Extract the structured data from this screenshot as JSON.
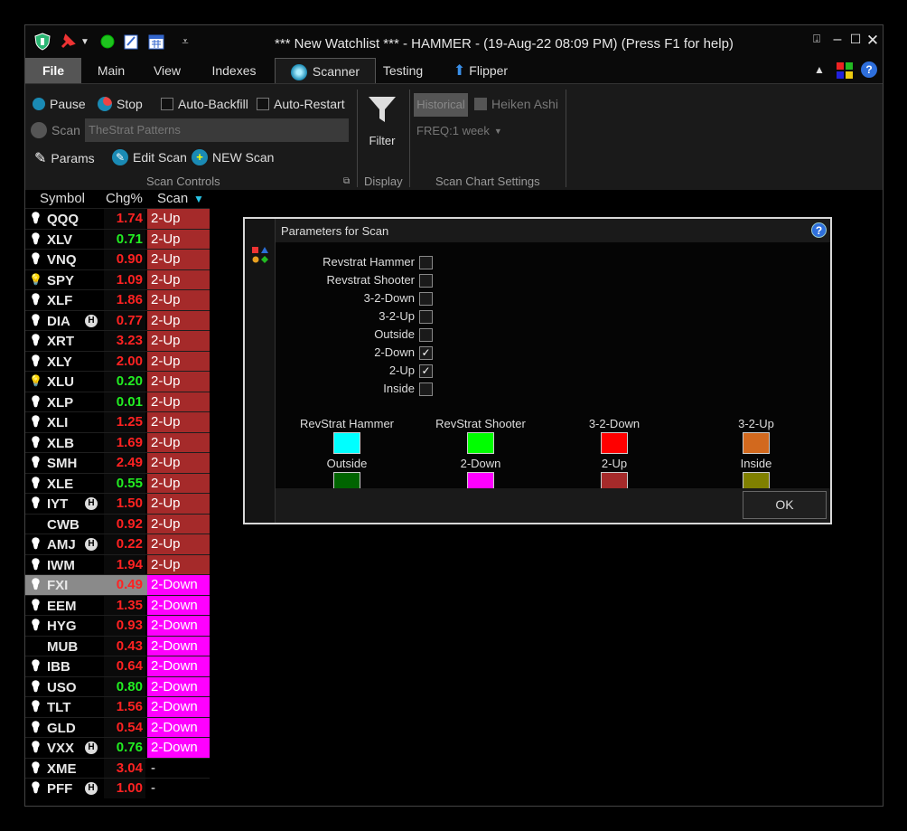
{
  "titlebar": {
    "title": "*** New Watchlist *** - HAMMER - (19-Aug-22 08:09 PM) (Press F1 for help)",
    "icons": [
      "shield-icon",
      "pin-icon",
      "dropdown-arrow-icon",
      "green-dot-icon",
      "notepad-icon",
      "calendar-icon",
      "dropdown-menu-icon"
    ],
    "controls": [
      "pin-window-icon",
      "minimize-icon",
      "maximize-icon",
      "close-icon"
    ]
  },
  "menu": {
    "tabs": [
      {
        "label": "File"
      },
      {
        "label": "Main"
      },
      {
        "label": "View"
      },
      {
        "label": "Indexes"
      },
      {
        "label": "Scanner"
      },
      {
        "label": "Testing"
      },
      {
        "label": "Flipper"
      }
    ]
  },
  "ribbon": {
    "pause_label": "Pause",
    "stop_label": "Stop",
    "auto_backfill_label": "Auto-Backfill",
    "auto_restart_label": "Auto-Restart",
    "scan_label": "Scan",
    "scan_name": "TheStrat Patterns",
    "params_label": "Params",
    "edit_scan_label": "Edit Scan",
    "new_scan_label": "NEW Scan",
    "filter_label": "Filter",
    "historical_label": "Historical",
    "heiken_ashi_label": "Heiken Ashi",
    "freq_label": "FREQ:1 week",
    "groups": {
      "scan_controls": "Scan Controls",
      "display": "Display",
      "scan_chart_settings": "Scan Chart Settings"
    }
  },
  "watchlist": {
    "headers": {
      "symbol": "Symbol",
      "chg": "Chg%",
      "scan": "Scan"
    },
    "rows": [
      {
        "symbol": "QQQ",
        "chg": "1.74",
        "scan": "2-Up",
        "up": false,
        "h": false,
        "bulb": "white"
      },
      {
        "symbol": "XLV",
        "chg": "0.71",
        "scan": "2-Up",
        "up": true,
        "h": false,
        "bulb": "white"
      },
      {
        "symbol": "VNQ",
        "chg": "0.90",
        "scan": "2-Up",
        "up": false,
        "h": false,
        "bulb": "white"
      },
      {
        "symbol": "SPY",
        "chg": "1.09",
        "scan": "2-Up",
        "up": false,
        "h": false,
        "bulb": "yellow"
      },
      {
        "symbol": "XLF",
        "chg": "1.86",
        "scan": "2-Up",
        "up": false,
        "h": false,
        "bulb": "white"
      },
      {
        "symbol": "DIA",
        "chg": "0.77",
        "scan": "2-Up",
        "up": false,
        "h": true,
        "bulb": "white"
      },
      {
        "symbol": "XRT",
        "chg": "3.23",
        "scan": "2-Up",
        "up": false,
        "h": false,
        "bulb": "white"
      },
      {
        "symbol": "XLY",
        "chg": "2.00",
        "scan": "2-Up",
        "up": false,
        "h": false,
        "bulb": "white"
      },
      {
        "symbol": "XLU",
        "chg": "0.20",
        "scan": "2-Up",
        "up": true,
        "h": false,
        "bulb": "yellow"
      },
      {
        "symbol": "XLP",
        "chg": "0.01",
        "scan": "2-Up",
        "up": true,
        "h": false,
        "bulb": "white"
      },
      {
        "symbol": "XLI",
        "chg": "1.25",
        "scan": "2-Up",
        "up": false,
        "h": false,
        "bulb": "white"
      },
      {
        "symbol": "XLB",
        "chg": "1.69",
        "scan": "2-Up",
        "up": false,
        "h": false,
        "bulb": "white"
      },
      {
        "symbol": "SMH",
        "chg": "2.49",
        "scan": "2-Up",
        "up": false,
        "h": false,
        "bulb": "white"
      },
      {
        "symbol": "XLE",
        "chg": "0.55",
        "scan": "2-Up",
        "up": true,
        "h": false,
        "bulb": "white"
      },
      {
        "symbol": "IYT",
        "chg": "1.50",
        "scan": "2-Up",
        "up": false,
        "h": true,
        "bulb": "white"
      },
      {
        "symbol": "CWB",
        "chg": "0.92",
        "scan": "2-Up",
        "up": false,
        "h": false,
        "bulb": "none"
      },
      {
        "symbol": "AMJ",
        "chg": "0.22",
        "scan": "2-Up",
        "up": false,
        "h": true,
        "bulb": "white"
      },
      {
        "symbol": "IWM",
        "chg": "1.94",
        "scan": "2-Up",
        "up": false,
        "h": false,
        "bulb": "white"
      },
      {
        "symbol": "FXI",
        "chg": "0.49",
        "scan": "2-Down",
        "up": false,
        "h": false,
        "bulb": "white",
        "selected": true
      },
      {
        "symbol": "EEM",
        "chg": "1.35",
        "scan": "2-Down",
        "up": false,
        "h": false,
        "bulb": "white"
      },
      {
        "symbol": "HYG",
        "chg": "0.93",
        "scan": "2-Down",
        "up": false,
        "h": false,
        "bulb": "white"
      },
      {
        "symbol": "MUB",
        "chg": "0.43",
        "scan": "2-Down",
        "up": false,
        "h": false,
        "bulb": "none"
      },
      {
        "symbol": "IBB",
        "chg": "0.64",
        "scan": "2-Down",
        "up": false,
        "h": false,
        "bulb": "white"
      },
      {
        "symbol": "USO",
        "chg": "0.80",
        "scan": "2-Down",
        "up": true,
        "h": false,
        "bulb": "white"
      },
      {
        "symbol": "TLT",
        "chg": "1.56",
        "scan": "2-Down",
        "up": false,
        "h": false,
        "bulb": "white"
      },
      {
        "symbol": "GLD",
        "chg": "0.54",
        "scan": "2-Down",
        "up": false,
        "h": false,
        "bulb": "white"
      },
      {
        "symbol": "VXX",
        "chg": "0.76",
        "scan": "2-Down",
        "up": true,
        "h": true,
        "bulb": "white"
      },
      {
        "symbol": "XME",
        "chg": "3.04",
        "scan": "-",
        "up": false,
        "h": false,
        "bulb": "white"
      },
      {
        "symbol": "PFF",
        "chg": "1.00",
        "scan": "-",
        "up": false,
        "h": true,
        "bulb": "white"
      }
    ]
  },
  "dialog": {
    "title": "Parameters for Scan",
    "options": [
      {
        "label": "Revstrat Hammer",
        "checked": false
      },
      {
        "label": "Revstrat Shooter",
        "checked": false
      },
      {
        "label": "3-2-Down",
        "checked": false
      },
      {
        "label": "3-2-Up",
        "checked": false
      },
      {
        "label": "Outside",
        "checked": false
      },
      {
        "label": "2-Down",
        "checked": true
      },
      {
        "label": "2-Up",
        "checked": true
      },
      {
        "label": "Inside",
        "checked": false
      }
    ],
    "legend": [
      {
        "label": "RevStrat Hammer",
        "color": "#00ffff"
      },
      {
        "label": "RevStrat Shooter",
        "color": "#00ff00"
      },
      {
        "label": "3-2-Down",
        "color": "#ff0000"
      },
      {
        "label": "3-2-Up",
        "color": "#d2691e"
      },
      {
        "label": "Outside",
        "color": "#006400"
      },
      {
        "label": "2-Down",
        "color": "#ff00ff"
      },
      {
        "label": "2-Up",
        "color": "#a52a2a"
      },
      {
        "label": "Inside",
        "color": "#808000"
      }
    ],
    "ok_label": "OK"
  },
  "colors": {
    "up": "#22ee22",
    "down": "#ff2222",
    "scan_2up": "#a52a2a",
    "scan_2down": "#ff00ff",
    "accent": "#2e6fdc"
  }
}
